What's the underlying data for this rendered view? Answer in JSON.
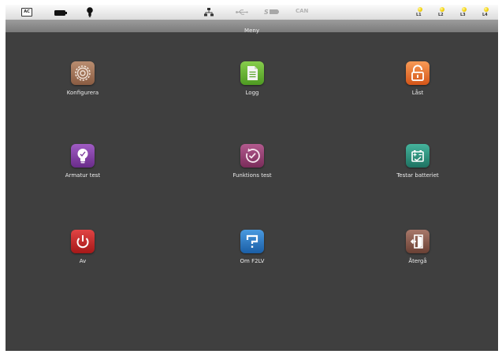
{
  "status_bar": {
    "ac_label": "AC",
    "can_label": "CAN",
    "icons": [
      "ac-power-icon",
      "battery-icon",
      "lightbulb-icon",
      "network-icon",
      "usb-icon",
      "sd-card-icon",
      "can-bus-icon"
    ],
    "lines": [
      {
        "label": "L1",
        "color": "#f2cf00"
      },
      {
        "label": "L2",
        "color": "#f2cf00"
      },
      {
        "label": "L3",
        "color": "#f2cf00"
      },
      {
        "label": "L4",
        "color": "#f2cf00"
      }
    ]
  },
  "title": "Meny",
  "menu": {
    "configure": {
      "label": "Konfigurera",
      "icon": "gear-icon",
      "color": "#9a6a4f"
    },
    "log": {
      "label": "Logg",
      "icon": "document-icon",
      "color": "#5aa52a"
    },
    "locked": {
      "label": "Låst",
      "icon": "padlock-icon",
      "color": "#e0672a"
    },
    "luminaire_test": {
      "label": "Armatur test",
      "icon": "lightbulb-icon",
      "color": "#7a3a9a"
    },
    "function_test": {
      "label": "Funktions test",
      "icon": "stopwatch-check-icon",
      "color": "#8e3a6c"
    },
    "battery_test": {
      "label": "Testar batteriet",
      "icon": "battery-test-icon",
      "color": "#2a8a76"
    },
    "off": {
      "label": "Av",
      "icon": "power-icon",
      "color": "#c42a2a"
    },
    "about": {
      "label": "Om F2LV",
      "icon": "question-mark-icon",
      "color": "#2a7ac4"
    },
    "back": {
      "label": "Återgå",
      "icon": "exit-door-icon",
      "color": "#8a5a4a"
    }
  },
  "colors": {
    "background": "#3f3f3f",
    "title_bar": "#8a8a8a",
    "status_bar": "#eeeeee",
    "label_text": "#ececec"
  }
}
